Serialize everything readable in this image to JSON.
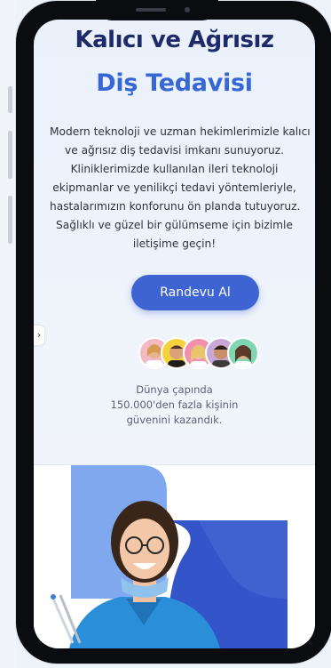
{
  "hero": {
    "title_line1": "Kalıcı ve Ağrısız",
    "title_line2": "Diş Tedavisi",
    "description_lines": [
      "Modern teknoloji ve uzman hekimlerimizle kalıcı",
      "ve ağrısız diş tedavisi imkanı sunuyoruz.",
      "Kliniklerimizde kullanılan ileri teknoloji",
      "ekipmanlar ve yenilikçi tedavi yöntemleriyle,",
      "hastalarımızın konforunu ön planda tutuyoruz.",
      "Sağlıklı ve güzel bir gülümseme için bizimle",
      "iletişime geçin!"
    ],
    "cta_label": "Randevu Al"
  },
  "trust": {
    "lines": [
      "Dünya çapında",
      "150.000'den fazla kişinin",
      "güvenini kazandık."
    ]
  },
  "side_toggle": {
    "icon": "chevron-right-icon",
    "glyph": "›"
  },
  "colors": {
    "title_dark": "#1f2a6a",
    "title_accent": "#3767d6",
    "button": "#3e64d3",
    "shape_light_blue": "#7fa8ee",
    "shape_dark_blue": "#3355c9"
  }
}
